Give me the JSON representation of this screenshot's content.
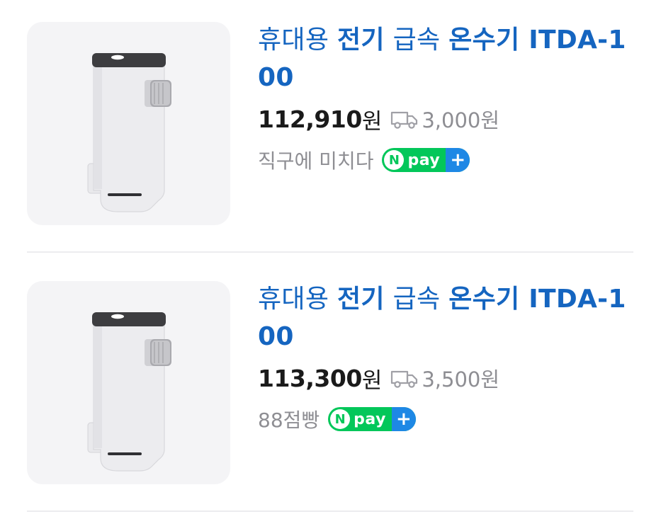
{
  "products": [
    {
      "title_parts": [
        "휴대용 ",
        "전기",
        " 급속 ",
        "온수기",
        " ITDA-100"
      ],
      "price": "112,910",
      "currency": "원",
      "shipping": "3,000원",
      "seller": "직구에 미치다",
      "pay_badge": {
        "n": "N",
        "text": "pay",
        "plus": "+"
      },
      "image_icon": "water-heater-product-image"
    },
    {
      "title_parts": [
        "휴대용 ",
        "전기",
        " 급속 ",
        "온수기",
        " ITDA-100"
      ],
      "price": "113,300",
      "currency": "원",
      "shipping": "3,500원",
      "seller": "88점빵",
      "pay_badge": {
        "n": "N",
        "text": "pay",
        "plus": "+"
      },
      "image_icon": "water-heater-product-image"
    }
  ],
  "colors": {
    "title": "#1565c0",
    "npay_green": "#03c75a",
    "npay_blue": "#1e88e5",
    "muted": "#8e8e93"
  },
  "icons": {
    "shipping": "truck-icon"
  }
}
